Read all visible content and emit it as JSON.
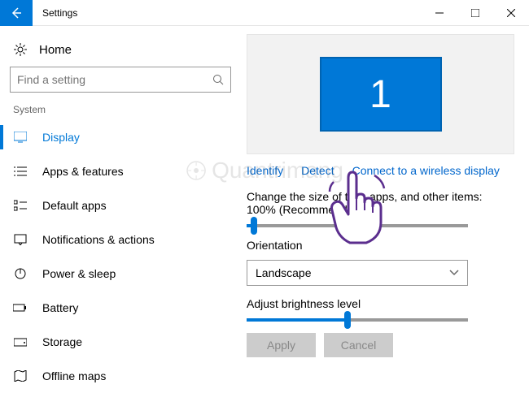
{
  "titlebar": {
    "title": "Settings"
  },
  "home": {
    "label": "Home"
  },
  "search": {
    "placeholder": "Find a setting"
  },
  "section": {
    "label": "System"
  },
  "nav": {
    "items": [
      {
        "label": "Display",
        "icon": "monitor"
      },
      {
        "label": "Apps & features",
        "icon": "list"
      },
      {
        "label": "Default apps",
        "icon": "defaults"
      },
      {
        "label": "Notifications & actions",
        "icon": "notification"
      },
      {
        "label": "Power & sleep",
        "icon": "power"
      },
      {
        "label": "Battery",
        "icon": "battery"
      },
      {
        "label": "Storage",
        "icon": "storage"
      },
      {
        "label": "Offline maps",
        "icon": "map"
      }
    ]
  },
  "display": {
    "monitor_number": "1",
    "links": {
      "identify": "Identify",
      "detect": "Detect",
      "wireless": "Connect to a wireless display"
    },
    "size_label": "Change the size of text, apps, and other items: 100% (Recommended)",
    "size_slider_percent": 2,
    "orientation_label": "Orientation",
    "orientation_value": "Landscape",
    "brightness_label": "Adjust brightness level",
    "brightness_percent": 44,
    "apply": "Apply",
    "cancel": "Cancel"
  },
  "watermark": "Quantrimang"
}
